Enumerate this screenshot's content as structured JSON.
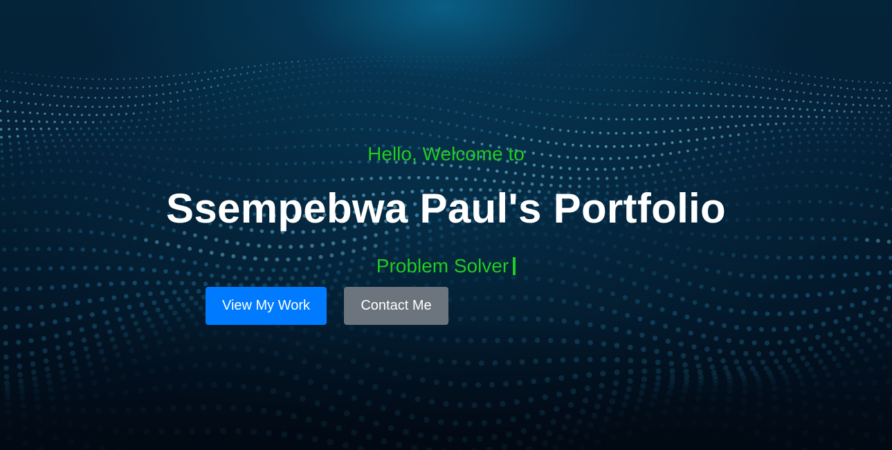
{
  "hero": {
    "greeting": "Hello, Welcome to",
    "title": "Ssempebwa Paul's Portfolio",
    "role": "Problem Solver",
    "buttons": {
      "primary_label": "View My Work",
      "secondary_label": "Contact Me"
    },
    "background": "particle-wave"
  },
  "colors": {
    "accent_green": "#22cc22",
    "primary_blue": "#007bff",
    "secondary_gray": "#6c757d",
    "title_white": "#ffffff",
    "bg_dark": "#031a2d"
  }
}
